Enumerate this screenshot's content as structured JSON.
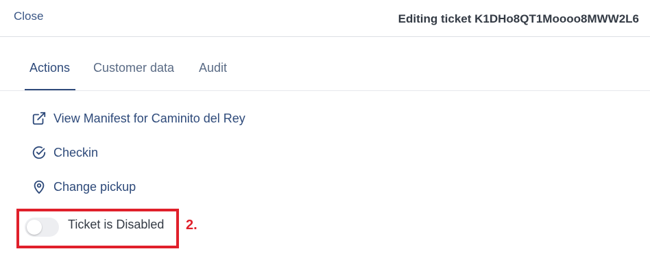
{
  "header": {
    "close_label": "Close",
    "title": "Editing ticket K1DHo8QT1Moooo8MWW2L6"
  },
  "tabs": [
    {
      "label": "Actions",
      "active": true
    },
    {
      "label": "Customer data",
      "active": false
    },
    {
      "label": "Audit",
      "active": false
    }
  ],
  "actions": [
    {
      "label": "View Manifest for Caminito del Rey",
      "icon": "external-link-icon"
    },
    {
      "label": "Checkin",
      "icon": "check-circle-icon"
    },
    {
      "label": "Change pickup",
      "icon": "map-pin-icon"
    }
  ],
  "ticket_toggle": {
    "label": "Ticket is Disabled",
    "enabled": false
  },
  "annotation": {
    "step": "2.",
    "color": "#e0202b"
  },
  "colors": {
    "primary": "#2e4a7a",
    "annotation": "#e0202b"
  }
}
